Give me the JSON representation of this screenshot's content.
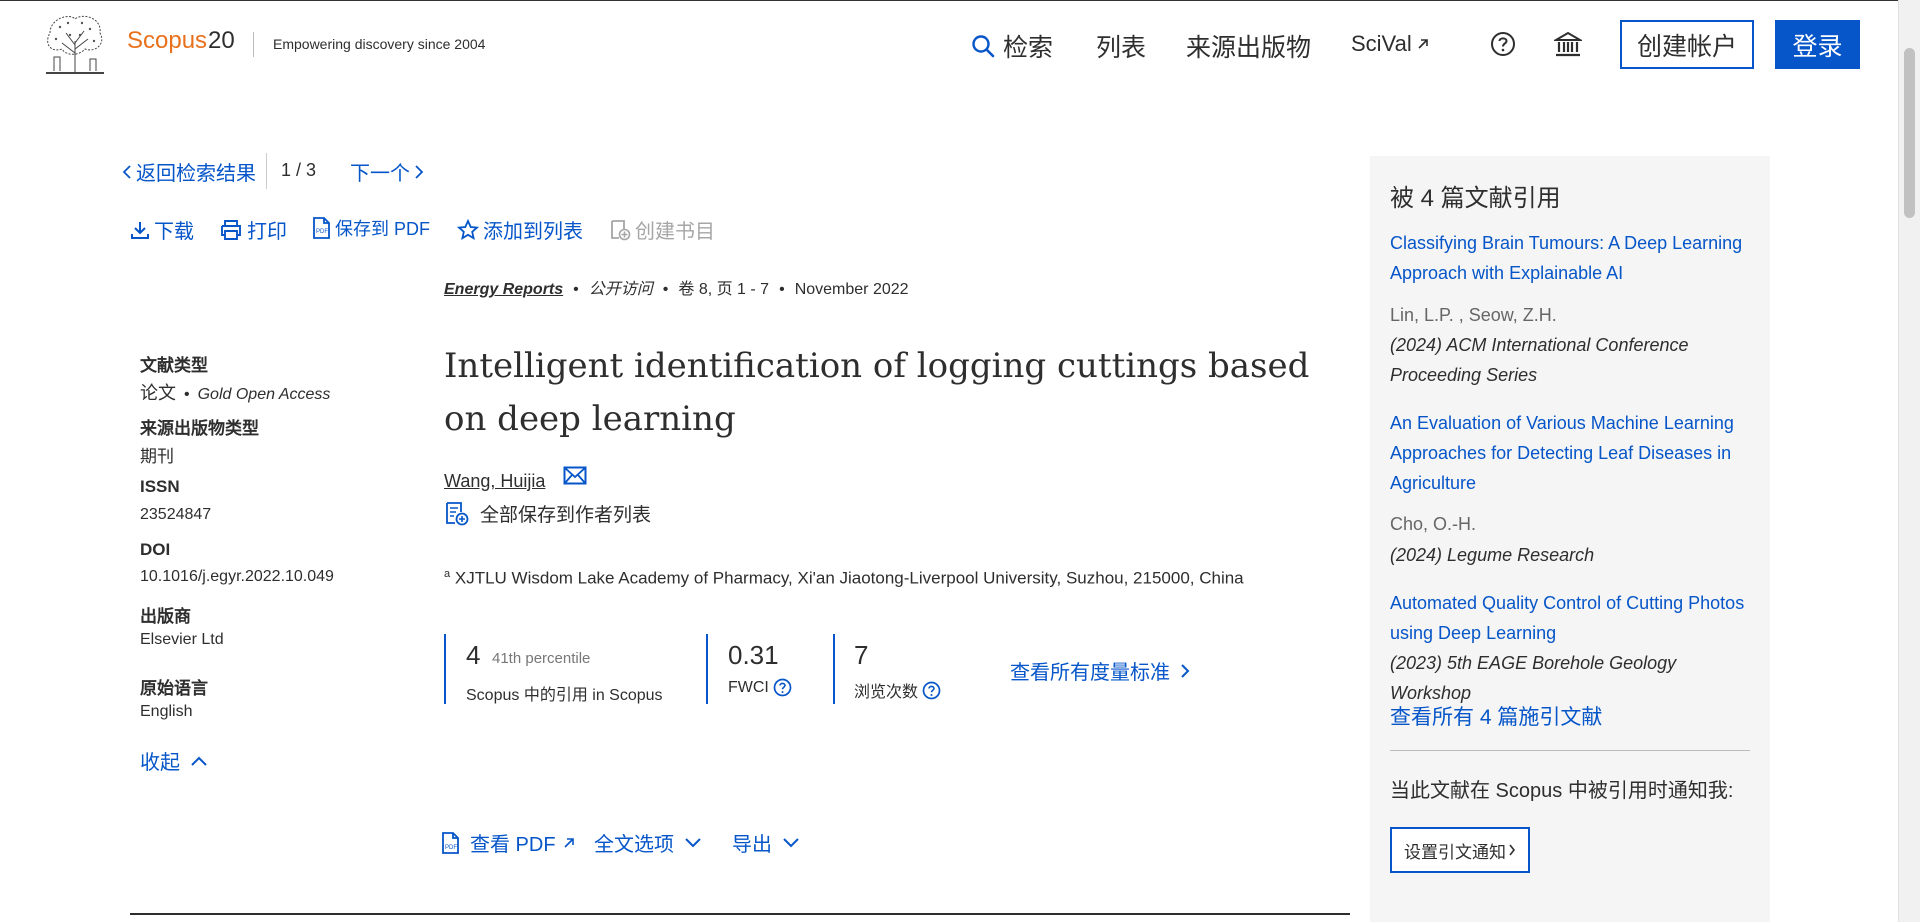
{
  "header": {
    "brand": "Scopus",
    "brand_number": "20",
    "tagline": "Empowering discovery since 2004",
    "nav": {
      "search": "检索",
      "lists": "列表",
      "sources": "来源出版物",
      "scival": "SciVal"
    },
    "create_account": "创建帐户",
    "login": "登录"
  },
  "docnav": {
    "back": "返回检索结果",
    "pager": "1 / 3",
    "next": "下一个"
  },
  "actions": {
    "download": "下载",
    "print": "打印",
    "save_pdf": "保存到 PDF",
    "add_list": "添加到列表",
    "create_bib": "创建书目"
  },
  "metadata": {
    "doc_type_label": "文献类型",
    "doc_type_value": "论文",
    "access_value": "Gold Open Access",
    "source_type_label": "来源出版物类型",
    "source_type_value": "期刊",
    "issn_label": "ISSN",
    "issn_value": "23524847",
    "doi_label": "DOI",
    "doi_value": "10.1016/j.egyr.2022.10.049",
    "publisher_label": "出版商",
    "publisher_value": "Elsevier Ltd",
    "language_label": "原始语言",
    "language_value": "English",
    "collapse": "收起"
  },
  "article": {
    "journal": "Energy Reports",
    "open_access": "公开访问",
    "volume_pages": "卷 8, 页 1 - 7",
    "date": "November 2022",
    "title": "Intelligent identification of logging cuttings based on deep learning",
    "author": "Wang, Huijia",
    "save_all_authors": "全部保存到作者列表",
    "affiliation_marker": "a",
    "affiliation": "XJTLU Wisdom Lake Academy of Pharmacy, Xi'an Jiaotong-Liverpool University, Suzhou, 215000, China"
  },
  "metrics": {
    "citations": "4",
    "percentile": "41th percentile",
    "citations_label": "Scopus 中的引用 in Scopus",
    "fwci": "0.31",
    "fwci_label": "FWCI",
    "views": "7",
    "views_label": "浏览次数",
    "all_metrics": "查看所有度量标准"
  },
  "bottom_actions": {
    "view_pdf": "查看 PDF",
    "full_text": "全文选项",
    "export": "导出"
  },
  "sidebar": {
    "title": "被 4 篇文献引用",
    "citations": [
      {
        "title": "Classifying Brain Tumours: A Deep Learning Approach with Explainable AI",
        "authors": "Lin, L.P. , Seow, Z.H.",
        "venue": "(2024) ACM International Conference Proceeding Series"
      },
      {
        "title": "An Evaluation of Various Machine Learning Approaches for Detecting Leaf Diseases in Agriculture",
        "authors": "Cho, O.-H.",
        "venue": "(2024) Legume Research"
      },
      {
        "title": "Automated Quality Control of Cutting Photos using Deep Learning",
        "authors": "",
        "venue": "(2023) 5th EAGE Borehole Geology Workshop"
      }
    ],
    "view_all": "查看所有 4 篇施引文献",
    "notify": "当此文献在 Scopus 中被引用时通知我:",
    "set_alert": "设置引文通知"
  },
  "colors": {
    "link": "#0656c9",
    "brand": "#e9711c",
    "text": "#2e2e2e",
    "sidebar_bg": "#f5f5f5"
  }
}
